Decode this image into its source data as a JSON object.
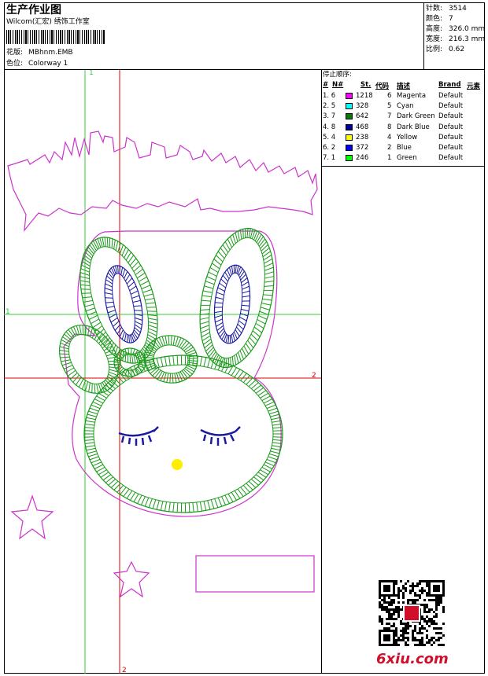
{
  "header": {
    "title": "生产作业图",
    "subtitle": "Wilcom(汇宏) 绣饰工作室",
    "design_label": "花版:",
    "design_value": "MBhnm.EMB",
    "colorway_label": "色位:",
    "colorway_value": "Colorway 1"
  },
  "stats": [
    {
      "label": "针数:",
      "value": "3514"
    },
    {
      "label": "颜色:",
      "value": "7"
    },
    {
      "label": "高度:",
      "value": "326.0 mm"
    },
    {
      "label": "宽度:",
      "value": "216.3 mm"
    },
    {
      "label": "比例:",
      "value": "0.62"
    }
  ],
  "stop_sequence": {
    "title": "停止顺序:",
    "columns": [
      "#",
      "N#",
      "St.",
      "代码",
      "描述",
      "Brand",
      "元素"
    ],
    "rows": [
      {
        "idx": "1. 6",
        "color": "#ff00ff",
        "st": "1218",
        "code": "6",
        "desc": "Magenta",
        "brand": "Default"
      },
      {
        "idx": "2. 5",
        "color": "#00ffff",
        "st": "328",
        "code": "5",
        "desc": "Cyan",
        "brand": "Default"
      },
      {
        "idx": "3. 7",
        "color": "#008000",
        "st": "642",
        "code": "7",
        "desc": "Dark Green",
        "brand": "Default"
      },
      {
        "idx": "4. 8",
        "color": "#0000a0",
        "st": "468",
        "code": "8",
        "desc": "Dark Blue",
        "brand": "Default"
      },
      {
        "idx": "5. 4",
        "color": "#ffff00",
        "st": "238",
        "code": "4",
        "desc": "Yellow",
        "brand": "Default"
      },
      {
        "idx": "6. 2",
        "color": "#0000ff",
        "st": "372",
        "code": "2",
        "desc": "Blue",
        "brand": "Default"
      },
      {
        "idx": "7. 1",
        "color": "#00ff00",
        "st": "246",
        "code": "1",
        "desc": "Green",
        "brand": "Default"
      }
    ]
  },
  "guides": {
    "v1": "1",
    "v2": "2",
    "h1": "1",
    "h2": "2"
  },
  "watermark": "6xiu.com",
  "colors": {
    "magenta": "#cc33cc",
    "green": "#1a9a1a",
    "blue": "#1a1aa0",
    "yellow": "#ffee00",
    "guide_green": "#33cc33",
    "guide_red": "#dd0000"
  }
}
